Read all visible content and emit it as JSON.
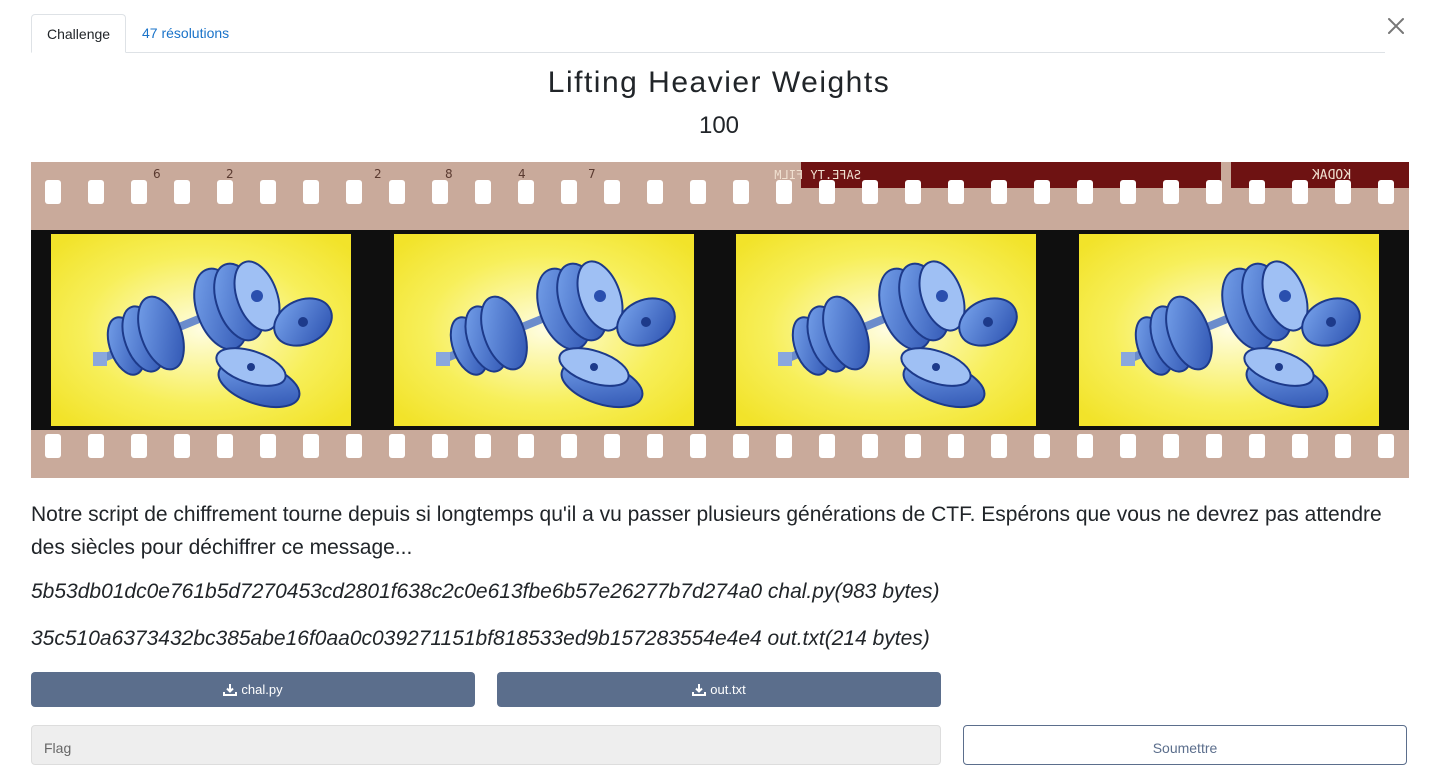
{
  "tabs": [
    {
      "label": "Challenge",
      "active": true
    },
    {
      "label": "47 résolutions",
      "active": false
    }
  ],
  "challenge": {
    "title": "Lifting Heavier Weights",
    "points": "100",
    "banner": {
      "film_marks": [
        "6",
        "2",
        "2",
        "8",
        "4",
        "7",
        "SAFE.TY FILM",
        "KODAK"
      ],
      "film_colors": {
        "film": "#c8a89a",
        "frame_gap": "#111111",
        "paper": "#f5ea3c",
        "plate": "#3f6fc8"
      }
    },
    "description": "Notre script de chiffrement tourne depuis si longtemps qu'il a vu passer plusieurs générations de CTF. Espérons que vous ne devrez pas attendre des siècles pour déchiffrer ce message...",
    "files": [
      {
        "hash": "5b53db01dc0e761b5d7270453cd2801f638c2c0e613fbe6b57e26277b7d274a0",
        "name": "chal.py",
        "size": "(983 bytes)"
      },
      {
        "hash": "35c510a6373432bc385abe16f0aa0c039271151bf818533ed9b157283554e4e4",
        "name": "out.txt",
        "size": "(214 bytes)"
      }
    ],
    "buttons": [
      "chal.py",
      "out.txt"
    ],
    "flag_placeholder": "Flag",
    "submit_label": "Soumettre"
  },
  "colors": {
    "button": "#5b6e8c",
    "link": "#1a73c9"
  }
}
